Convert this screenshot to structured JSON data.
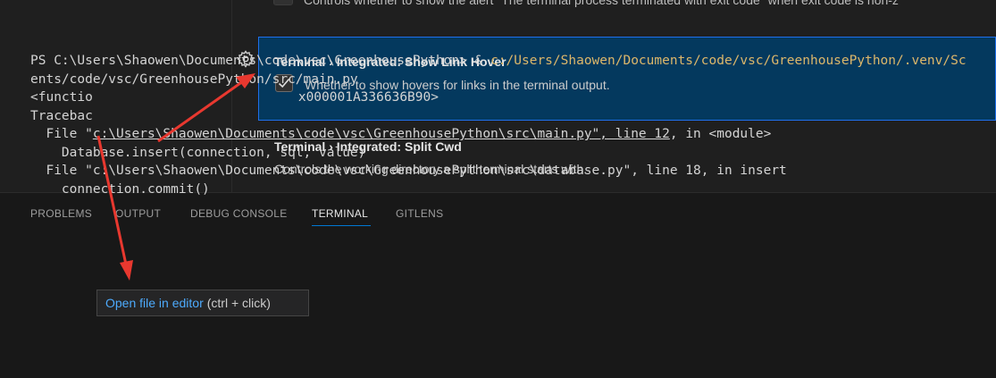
{
  "settings": {
    "partial_description": "Controls whether to show the alert \"The terminal process terminated with exit code\" when exit code is non-z",
    "show_link_hover": {
      "category": "Terminal › Integrated: ",
      "name": "Show Link Hover",
      "description": "Whether to show hovers for links in the terminal output.",
      "checked": true
    },
    "split_cwd": {
      "category": "Terminal › Integrated: ",
      "name": "Split Cwd",
      "description": "Controls the working directory a split terminal starts with."
    }
  },
  "panel": {
    "tabs": [
      "PROBLEMS",
      "OUTPUT",
      "DEBUG CONSOLE",
      "TERMINAL",
      "GITLENS"
    ],
    "active_tab": "TERMINAL"
  },
  "terminal": {
    "line1_prompt": "PS C:\\Users\\Shaowen\\Documents\\code\\vsc\\GreenhousePython> & ",
    "line1_path": "c:/Users/Shaowen/Documents/code/vsc/GreenhousePython/.venv/Sc",
    "line2": "ents/code/vsc/GreenhousePython/src/main.py",
    "line3_start": "<functio",
    "line3_end": "x000001A336636B90>",
    "line4": "Tracebac",
    "line5_prefix": "  File \"",
    "line5_link": "c:\\Users\\Shaowen\\Documents\\code\\vsc\\GreenhousePython\\src\\main.py\", line 12",
    "line5_suffix": ", in <module>",
    "line6": "    Database.insert(connection, sql, value)",
    "line7": "  File \"c:\\Users\\Shaowen\\Documents\\code\\vsc\\GreenhousePython\\src\\database.py\", line 18, in insert",
    "line8": "    connection.commit()"
  },
  "hover": {
    "link_label": "Open file in editor",
    "shortcut": "(ctrl + click)"
  },
  "colors": {
    "accent": "#0078d4",
    "focus_bg": "#04395e",
    "annotation_arrow": "#e8382f"
  }
}
